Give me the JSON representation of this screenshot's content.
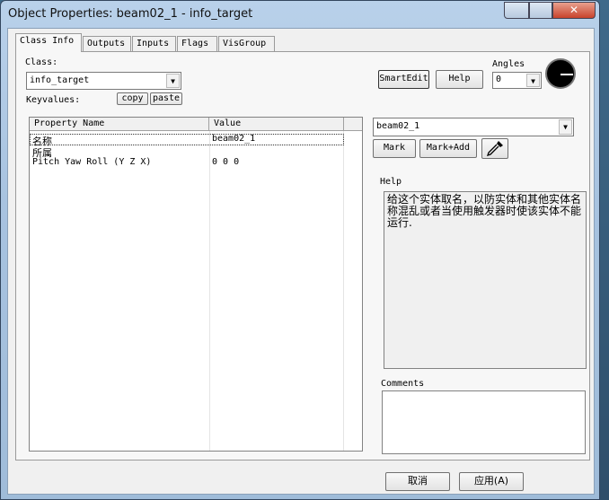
{
  "window": {
    "title": "Object Properties: beam02_1 - info_target"
  },
  "tabs": [
    {
      "label": "Class Info"
    },
    {
      "label": "Outputs"
    },
    {
      "label": "Inputs"
    },
    {
      "label": "Flags"
    },
    {
      "label": "VisGroup"
    }
  ],
  "class_info": {
    "class_label": "Class:",
    "class_value": "info_target",
    "keyvalues_label": "Keyvalues:",
    "copy_label": "copy",
    "paste_label": "paste",
    "smartedit_label": "SmartEdit",
    "help_label": "Help",
    "angles_label": "Angles",
    "angles_value": "0"
  },
  "properties": {
    "col_name": "Property Name",
    "col_value": "Value",
    "rows": [
      {
        "name": "名称",
        "value": "beam02_1"
      },
      {
        "name": "所属",
        "value": ""
      },
      {
        "name": "Pitch Yaw Roll (Y Z X)",
        "value": "0 0 0"
      }
    ]
  },
  "value_editor": {
    "value": "beam02_1",
    "mark_label": "Mark",
    "markadd_label": "Mark+Add"
  },
  "help": {
    "group_label": "Help",
    "text": "给这个实体取名，以防实体和其他实体名称混乱或者当使用触发器时使该实体不能运行."
  },
  "comments": {
    "label": "Comments"
  },
  "footer": {
    "cancel_label": "取消",
    "apply_label": "应用(A)"
  }
}
